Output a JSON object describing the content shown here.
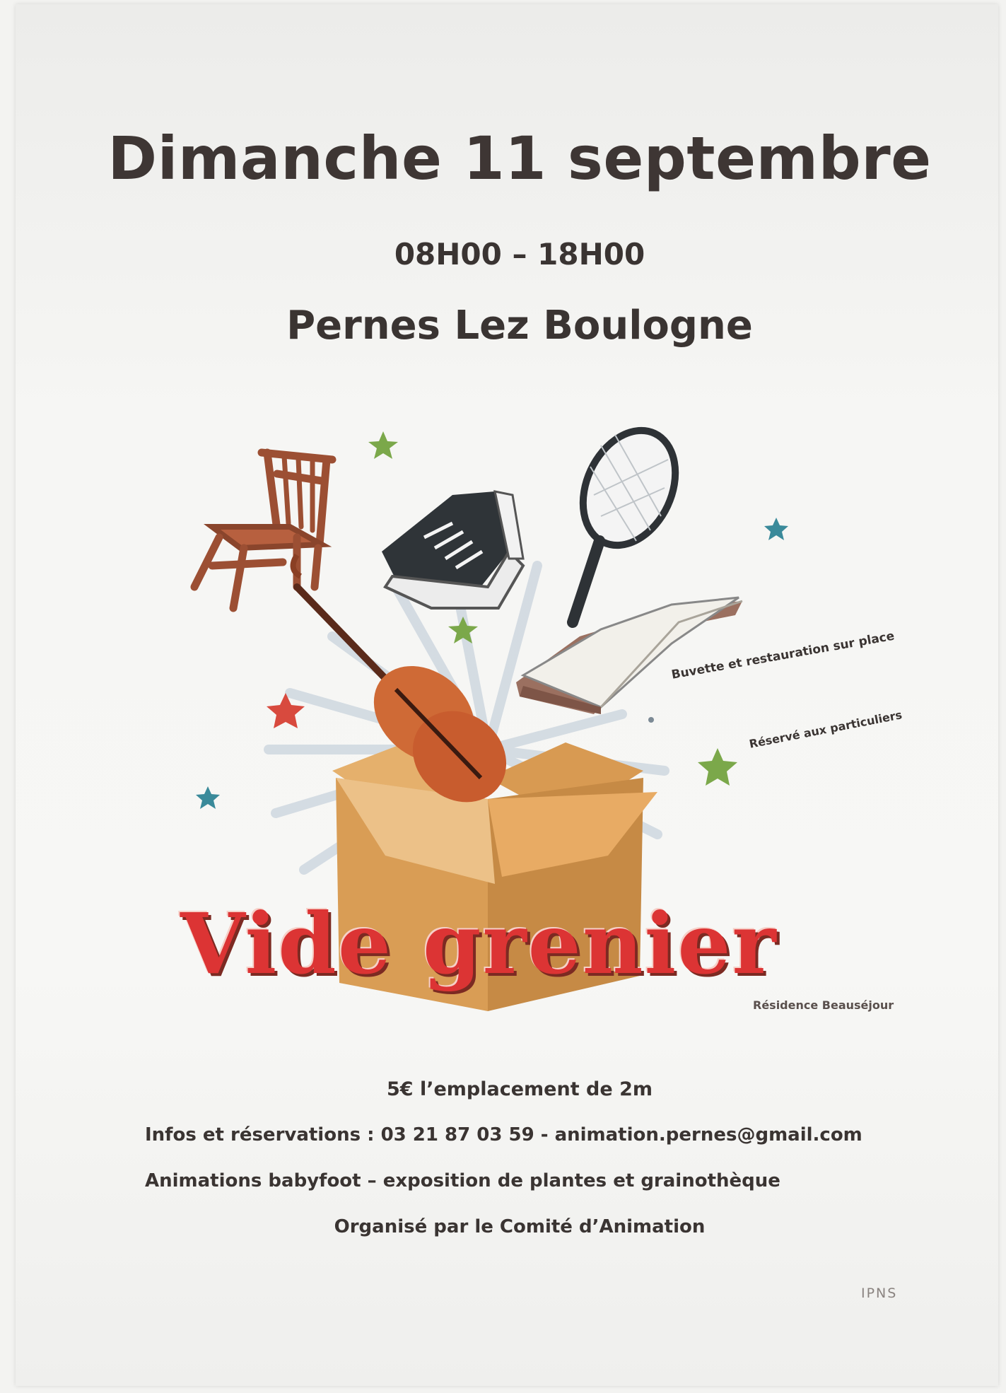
{
  "poster": {
    "date": "Dimanche 11 septembre",
    "hours": "08H00 – 18H00",
    "place": "Pernes Lez Boulogne",
    "event_title": "Vide grenier",
    "residence": "Résidence Beauséjour",
    "note_buvette": "Buvette et restauration sur place",
    "note_reserve": "Réservé aux particuliers",
    "price": "5€ l’emplacement de 2m",
    "infos": "Infos et réservations : 03 21 87 03 59 - animation.pernes@gmail.com",
    "animations": "Animations babyfoot – exposition de plantes et grainothèque",
    "organizer": "Organisé par le Comité d’Animation",
    "ipns": "IPNS"
  },
  "illustration": {
    "objects": [
      "chair-icon",
      "sneaker-icon",
      "tennis-racket-icon",
      "book-icon",
      "violin-icon",
      "cardboard-box-icon",
      "star-icon"
    ],
    "colors": {
      "title_red": "#dc3434",
      "box": "#e0a25a",
      "chair": "#a55a3c",
      "violin": "#cf6f3d",
      "star_green": "#7ba84a",
      "star_teal": "#3a8a9a",
      "star_red": "#d84a3e",
      "text": "#3a3432"
    }
  }
}
